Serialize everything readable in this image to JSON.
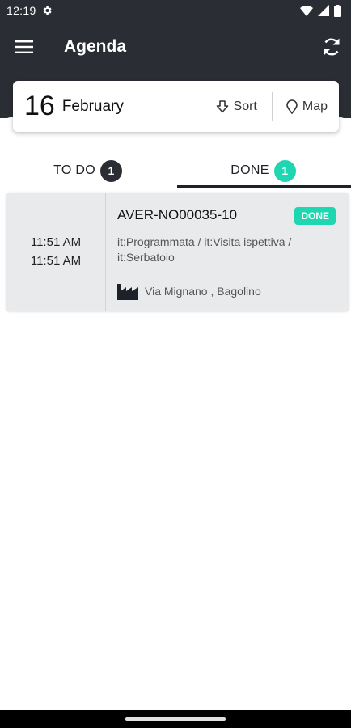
{
  "status_bar": {
    "time": "12:19",
    "icons": [
      "settings-icon",
      "wifi-icon",
      "signal-icon",
      "battery-icon"
    ]
  },
  "app_bar": {
    "title": "Agenda",
    "menu_icon": "menu-icon",
    "refresh_icon": "refresh-icon"
  },
  "date_card": {
    "day": "16",
    "month": "February",
    "sort_label": "Sort",
    "map_label": "Map"
  },
  "tabs": [
    {
      "label": "TO DO",
      "count": "1"
    },
    {
      "label": "DONE",
      "count": "1",
      "selected": true
    }
  ],
  "appointments": [
    {
      "start_time": "11:51 AM",
      "end_time": "11:51 AM",
      "code": "AVER-NO00035-10",
      "status": "DONE",
      "types_line1": "it:Programmata / it:Visita ispettiva /",
      "types_line2": "it:Serbatoio",
      "location": "Via Mignano , Bagolino"
    }
  ],
  "colors": {
    "header_bg": "#2b2d35",
    "accent": "#1ed6b0",
    "card_bg": "#e9eaec"
  }
}
